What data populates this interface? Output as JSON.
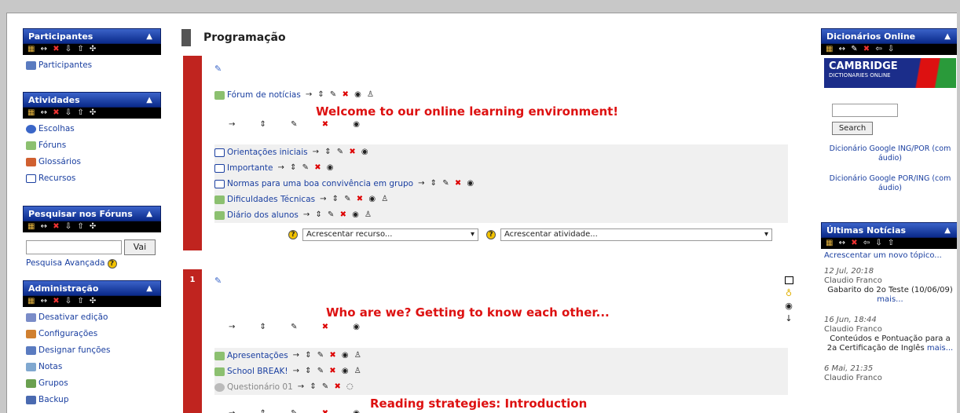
{
  "participantes": {
    "title": "Participantes",
    "items": [
      "Participantes"
    ]
  },
  "atividades": {
    "title": "Atividades",
    "items": [
      "Escolhas",
      "Fóruns",
      "Glossários",
      "Recursos"
    ]
  },
  "pesquisar": {
    "title": "Pesquisar nos Fóruns",
    "button": "Vai",
    "advanced": "Pesquisa Avançada"
  },
  "administracao": {
    "title": "Administração",
    "items": [
      "Desativar edição",
      "Configurações",
      "Designar funções",
      "Notas",
      "Grupos",
      "Backup"
    ]
  },
  "main": {
    "title": "Programação",
    "section0": {
      "forum": "Fórum de notícias",
      "heading": "Welcome to our online learning environment!",
      "resources": [
        "Orientações iniciais",
        "Importante",
        "Normas para uma boa convivência em grupo",
        "Dificuldades Técnicas",
        "Diário dos alunos"
      ],
      "add_resource": "Acrescentar recurso...",
      "add_activity": "Acrescentar atividade..."
    },
    "section1": {
      "number": "1",
      "heading": "Who are we? Getting to know each other...",
      "items": [
        "Apresentações",
        "School BREAK!",
        "Questionário 01"
      ],
      "heading2": "Reading strategies: Introduction"
    }
  },
  "dicionarios": {
    "title": "Dicionários Online",
    "logo_main": "CAMBRIDGE",
    "logo_sub": "DICTIONARIES ONLINE",
    "search": "Search",
    "links": [
      "Dicionário Google ING/POR (com áudio)",
      "Dicionário Google POR/ING (com áudio)"
    ]
  },
  "noticias": {
    "title": "Últimas Notícias",
    "add": "Acrescentar um novo tópico...",
    "more": "mais...",
    "posts": [
      {
        "date": "12 Jul, 20:18",
        "author": "Claudio Franco",
        "text": "Gabarito do 2o Teste (10/06/09)"
      },
      {
        "date": "16 Jun, 18:44",
        "author": "Claudio Franco",
        "text": "Conteúdos e Pontuação para a 2a Certificação de Inglês"
      },
      {
        "date": "6 Mai, 21:35",
        "author": "Claudio Franco",
        "text": ""
      }
    ]
  }
}
